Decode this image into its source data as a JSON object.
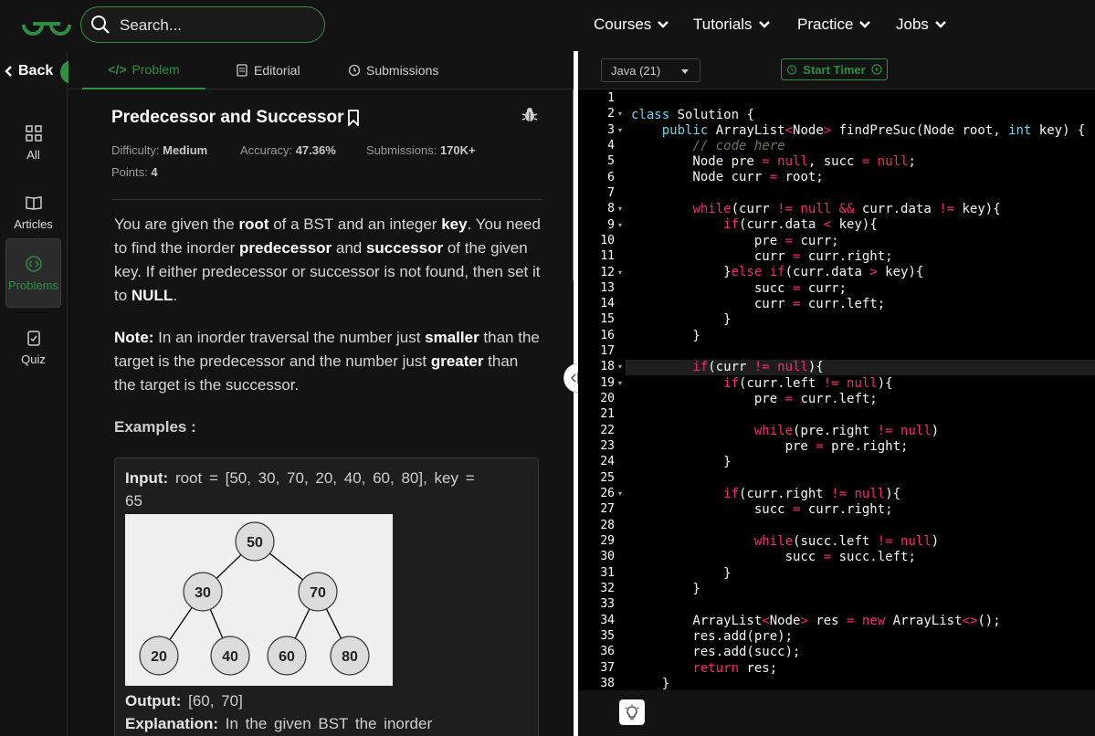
{
  "topnav": {
    "search_placeholder": "Search...",
    "menus": [
      "Courses",
      "Tutorials",
      "Practice",
      "Jobs"
    ]
  },
  "rail": {
    "back_label": "Back",
    "items": [
      {
        "label": "All",
        "icon": "grid-icon"
      },
      {
        "label": "Articles",
        "icon": "book-icon"
      },
      {
        "label": "Problems",
        "icon": "code-icon",
        "active": true
      },
      {
        "label": "Quiz",
        "icon": "quiz-icon"
      }
    ]
  },
  "tabs": [
    {
      "label": "Problem",
      "prefix": "</>",
      "active": true
    },
    {
      "label": "Editorial"
    },
    {
      "label": "Submissions"
    }
  ],
  "problem": {
    "title": "Predecessor and Successor",
    "difficulty_label": "Difficulty:",
    "difficulty": "Medium",
    "accuracy_label": "Accuracy:",
    "accuracy": "47.36%",
    "submissions_label": "Submissions:",
    "submissions": "170K+",
    "points_label": "Points:",
    "points": "4",
    "examples_heading": "Examples :",
    "example": {
      "input_label": "Input:",
      "input_line1": "root = [50, 30, 70, 20, 40, 60, 80], key =",
      "input_line2": "65",
      "output_label": "Output:",
      "output": "[60, 70]",
      "explanation_label": "Explanation:",
      "explanation": "In the given BST the inorder",
      "tree_nodes": [
        "50",
        "30",
        "70",
        "20",
        "40",
        "60",
        "80"
      ]
    }
  },
  "editor": {
    "language": "Java (21)",
    "timer_label": "Start Timer",
    "line_numbers": [
      "1",
      "2",
      "3",
      "4",
      "5",
      "6",
      "7",
      "8",
      "9",
      "10",
      "11",
      "12",
      "13",
      "14",
      "15",
      "16",
      "17",
      "18",
      "19",
      "20",
      "21",
      "22",
      "23",
      "24",
      "25",
      "26",
      "27",
      "28",
      "29",
      "30",
      "31",
      "32",
      "33",
      "34",
      "35",
      "36",
      "37",
      "38"
    ]
  },
  "colors": {
    "accent": "#2f8d46",
    "background": "#131313",
    "code_background": "#000000"
  }
}
